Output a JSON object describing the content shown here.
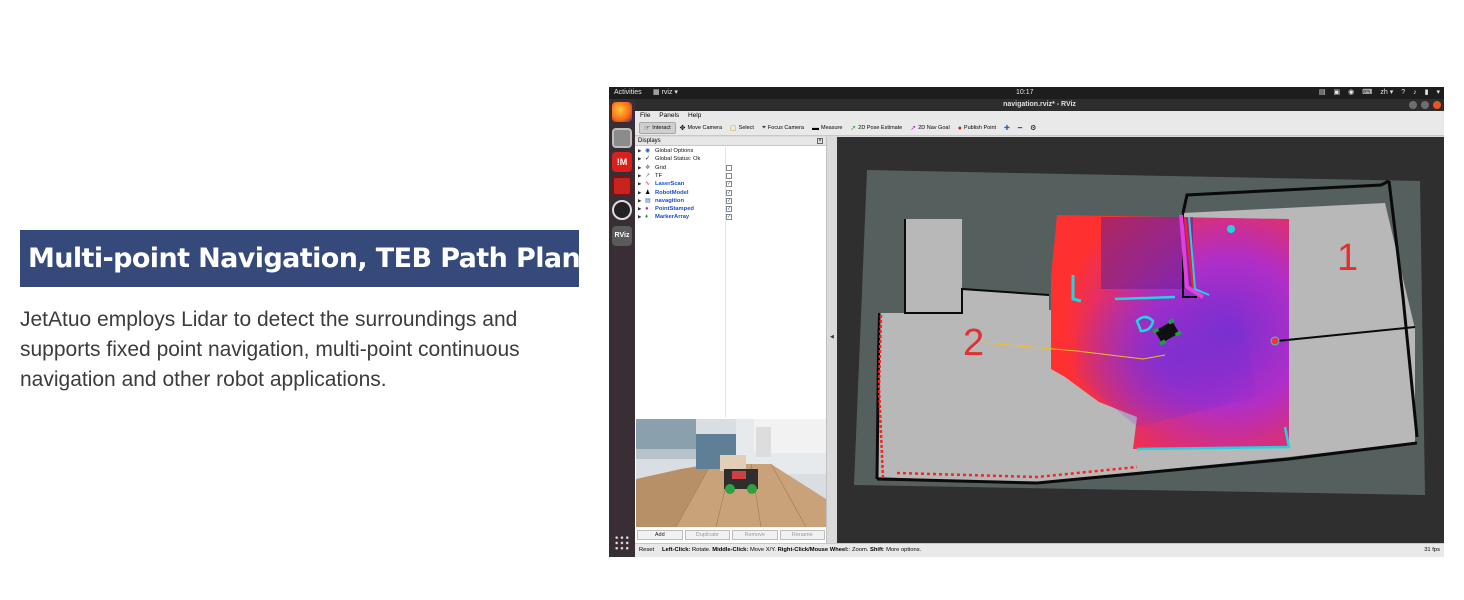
{
  "promo": {
    "headline": "Multi-point Navigation, TEB Path Planning",
    "description": "JetAtuo employs Lidar to detect the surroundings and supports fixed point navigation, multi-point continuous navigation and other robot applications."
  },
  "desktop": {
    "activities": "Activities",
    "app_name": "rviz",
    "clock": "10:17",
    "language": "zh"
  },
  "window": {
    "title": "navigation.rviz* - RViz",
    "menu": [
      "File",
      "Panels",
      "Help"
    ],
    "tools": [
      {
        "icon": "interact-icon",
        "label": "Interact",
        "active": true
      },
      {
        "icon": "move-camera-icon",
        "label": "Move Camera"
      },
      {
        "icon": "select-icon",
        "label": "Select"
      },
      {
        "icon": "focus-camera-icon",
        "label": "Focus Camera"
      },
      {
        "icon": "measure-icon",
        "label": "Measure"
      },
      {
        "icon": "pose-estimate-icon",
        "label": "2D Pose Estimate"
      },
      {
        "icon": "nav-goal-icon",
        "label": "2D Nav Goal"
      },
      {
        "icon": "publish-point-icon",
        "label": "Publish Point"
      }
    ]
  },
  "displays": {
    "title": "Displays",
    "items": [
      {
        "label": "Global Options",
        "checkbox": null,
        "highlight": false
      },
      {
        "label": "Global Status: Ok",
        "checkbox": null,
        "highlight": false
      },
      {
        "label": "Grid",
        "checkbox": false,
        "highlight": false
      },
      {
        "label": "TF",
        "checkbox": false,
        "highlight": false
      },
      {
        "label": "LaserScan",
        "checkbox": true,
        "highlight": true
      },
      {
        "label": "RobotModel",
        "checkbox": true,
        "highlight": true
      },
      {
        "label": "navagition",
        "checkbox": true,
        "highlight": true
      },
      {
        "label": "PointStamped",
        "checkbox": true,
        "highlight": true
      },
      {
        "label": "MarkerArray",
        "checkbox": true,
        "highlight": true
      }
    ],
    "buttons": {
      "add": "Add",
      "duplicate": "Duplicate",
      "remove": "Remove",
      "rename": "Rename"
    }
  },
  "map": {
    "waypoint_1": "1",
    "waypoint_2": "2",
    "colors": {
      "unknown": "#55605e",
      "free": "#b8b8b8",
      "wall": "#0a0a0a",
      "laser": "#ff2020",
      "inflation": "#22d3e0"
    }
  },
  "status": {
    "reset": "Reset",
    "hint_lc": "Left-Click:",
    "hint_lc_v": " Rotate. ",
    "hint_mc": "Middle-Click:",
    "hint_mc_v": " Move X/Y. ",
    "hint_rc": "Right-Click/Mouse Wheel:",
    "hint_rc_v": ": Zoom. ",
    "hint_sh": "Shift",
    "hint_sh_v": ": More options.",
    "fps": "31 fps"
  }
}
